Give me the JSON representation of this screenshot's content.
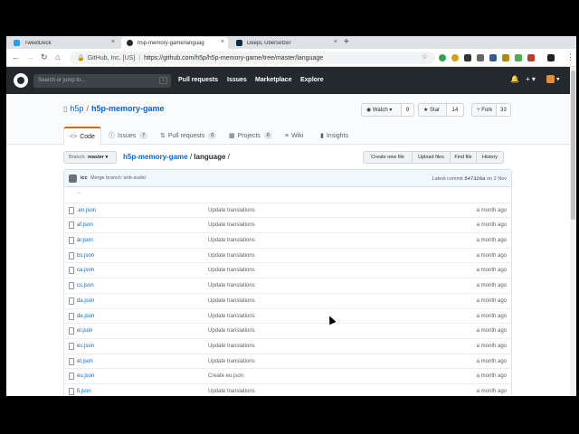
{
  "browser": {
    "tabs": [
      {
        "title": "TweetDeck",
        "color": "#1da1f2",
        "active": false
      },
      {
        "title": "h5p-memory-game/languag",
        "color": "#24292e",
        "active": true
      },
      {
        "title": "DeepL Übersetzer",
        "color": "#0f2b46",
        "active": false
      }
    ],
    "new_tab": "+",
    "close_glyph": "×",
    "nav": {
      "back": "←",
      "forward": "→",
      "reload": "↻",
      "home": "⌂"
    },
    "security_label": "GitHub, Inc. [US]",
    "separator": "|",
    "url": "https://github.com/h5p/h5p-memory-game/tree/master/language",
    "bookmark_icon": "☆",
    "menu_icon": "⋮"
  },
  "github": {
    "search_placeholder": "Search or jump to...",
    "search_hint": "/",
    "nav": [
      "Pull requests",
      "Issues",
      "Marketplace",
      "Explore"
    ],
    "bell": "🔔",
    "plus": "+ ▾",
    "avatar": "▾"
  },
  "repo": {
    "owner": "h5p",
    "slash": "/",
    "name": "h5p-memory-game",
    "watch": {
      "label": "◉ Watch ▾",
      "count": "9"
    },
    "star": {
      "label": "★ Star",
      "count": "14"
    },
    "fork": {
      "label": "⑂ Fork",
      "count": "33"
    },
    "tabs": [
      {
        "icon": "<>",
        "label": "Code",
        "count": ""
      },
      {
        "icon": "ⓘ",
        "label": "Issues",
        "count": "7"
      },
      {
        "icon": "⇅",
        "label": "Pull requests",
        "count": "0"
      },
      {
        "icon": "▦",
        "label": "Projects",
        "count": "0"
      },
      {
        "icon": "≡",
        "label": "Wiki",
        "count": ""
      },
      {
        "icon": "▮",
        "label": "Insights",
        "count": ""
      }
    ]
  },
  "filenav": {
    "branch_label": "Branch:",
    "branch": "master ▾",
    "crumb_repo": "h5p-memory-game",
    "crumb_sep": "/",
    "crumb_dir": "language",
    "crumb_trail": "/",
    "buttons": [
      "Create new file",
      "Upload files",
      "Find file",
      "History"
    ]
  },
  "commit": {
    "author": "icc",
    "message": "Merge branch 'anb-audio'",
    "latest_label": "Latest commit",
    "sha": "547326a",
    "date": "on 2 Nov"
  },
  "files": [
    {
      "name": "..",
      "message": "",
      "age": ""
    },
    {
      "name": ".en.json",
      "message": "Update translations",
      "age": "a month ago"
    },
    {
      "name": "af.json",
      "message": "Update translations",
      "age": "a month ago"
    },
    {
      "name": "ar.json",
      "message": "Update translations",
      "age": "a month ago"
    },
    {
      "name": "bs.json",
      "message": "Update translations",
      "age": "a month ago"
    },
    {
      "name": "ca.json",
      "message": "Update translations",
      "age": "a month ago"
    },
    {
      "name": "cs.json",
      "message": "Update translations",
      "age": "a month ago"
    },
    {
      "name": "da.json",
      "message": "Update translations",
      "age": "a month ago"
    },
    {
      "name": "de.json",
      "message": "Update translations",
      "age": "a month ago"
    },
    {
      "name": "el.json",
      "message": "Update translations",
      "age": "a month ago"
    },
    {
      "name": "es.json",
      "message": "Update translations",
      "age": "a month ago"
    },
    {
      "name": "et.json",
      "message": "Update translations",
      "age": "a month ago"
    },
    {
      "name": "eu.json",
      "message": "Create eu.json",
      "age": "a month ago"
    },
    {
      "name": "fi.json",
      "message": "Update translations",
      "age": "a month ago"
    }
  ]
}
